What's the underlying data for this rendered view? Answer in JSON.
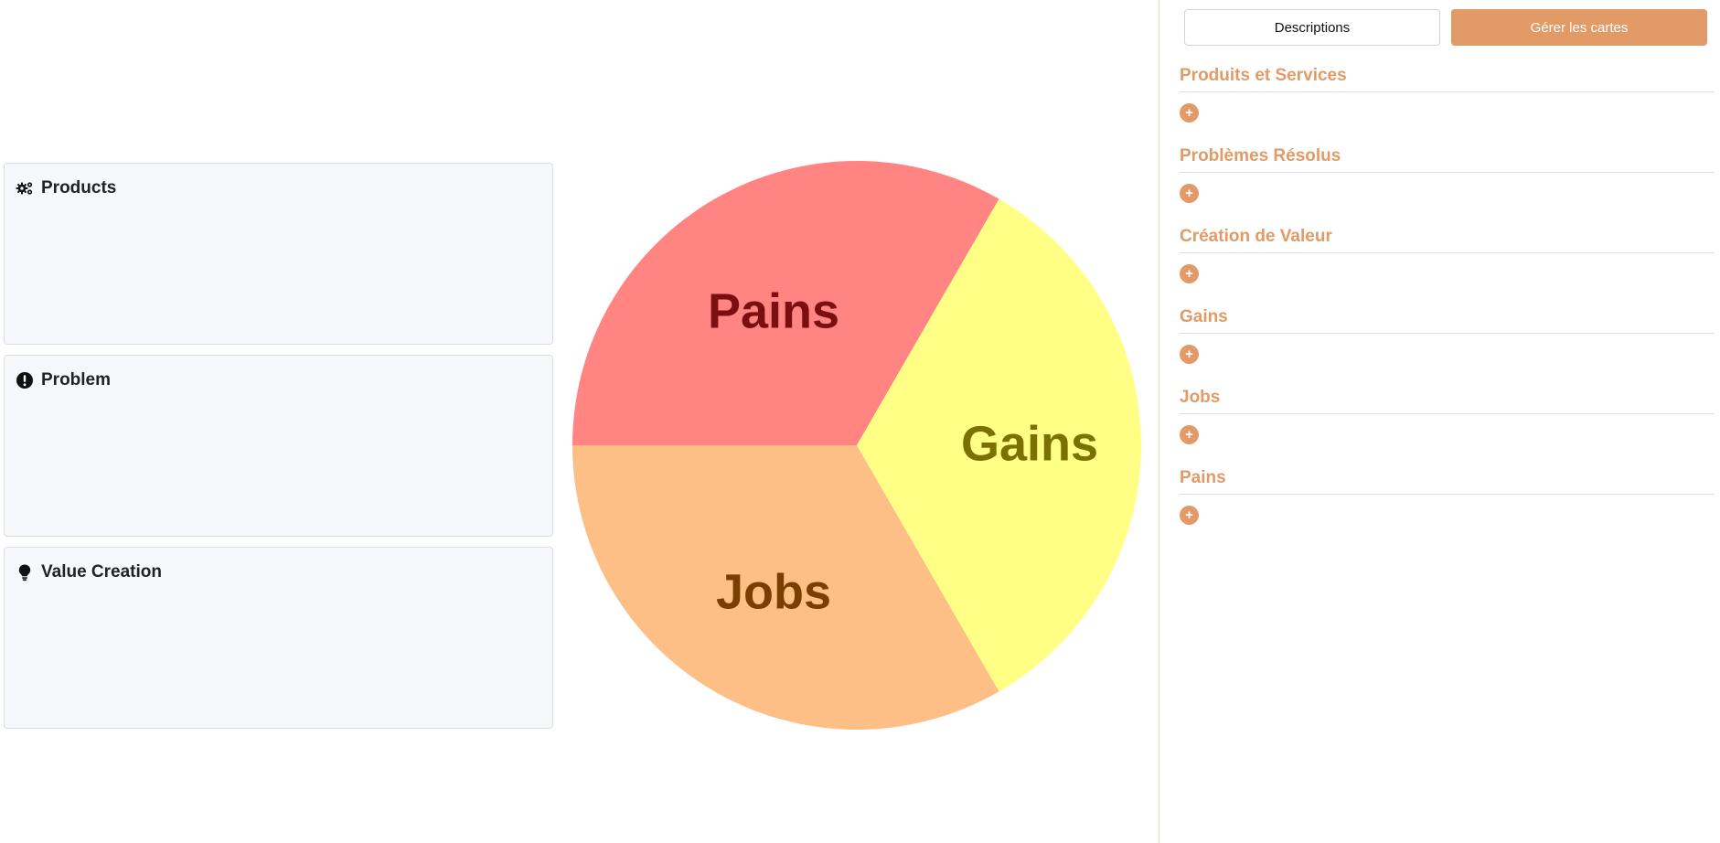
{
  "cards": [
    {
      "title": "Products",
      "icon": "gears-icon"
    },
    {
      "title": "Problem",
      "icon": "exclamation-circle-icon"
    },
    {
      "title": "Value Creation",
      "icon": "lightbulb-icon"
    }
  ],
  "canvas": {
    "segments": [
      {
        "label": "Pains",
        "color": "#ff8482",
        "text_color": "#7a0f0f"
      },
      {
        "label": "Gains",
        "color": "#ffff85",
        "text_color": "#7a7200"
      },
      {
        "label": "Jobs",
        "color": "#fdbf85",
        "text_color": "#7a3f00"
      }
    ]
  },
  "panel": {
    "tabs": {
      "descriptions": "Descriptions",
      "manage": "Gérer les cartes"
    },
    "sections": [
      {
        "title": "Produits et Services",
        "add": "+"
      },
      {
        "title": "Problèmes Résolus",
        "add": "+"
      },
      {
        "title": "Création de Valeur",
        "add": "+"
      },
      {
        "title": "Gains",
        "add": "+"
      },
      {
        "title": "Jobs",
        "add": "+"
      },
      {
        "title": "Pains",
        "add": "+"
      }
    ]
  },
  "colors": {
    "accent": "#e29b67",
    "card_bg": "#f7f8fc"
  }
}
